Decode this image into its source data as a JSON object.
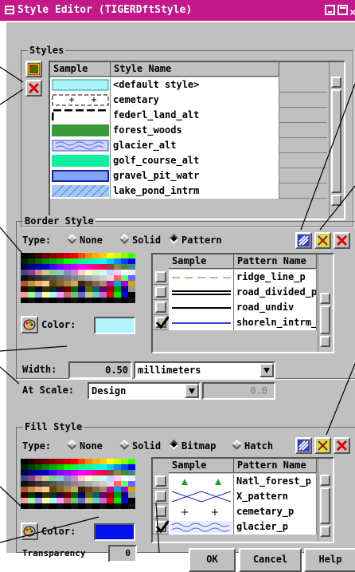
{
  "window": {
    "title": "Style Editor (TIGERDftStyle)"
  },
  "styles": {
    "group_label": "Styles",
    "col_sample": "Sample",
    "col_name": "Style Name",
    "rows": [
      {
        "name": "<default style>",
        "sample": "default"
      },
      {
        "name": "cemetary",
        "sample": "cemetary"
      },
      {
        "name": "federl_land_alt",
        "sample": "federal"
      },
      {
        "name": "forest_woods",
        "sample": "forest"
      },
      {
        "name": "glacier_alt",
        "sample": "glacier"
      },
      {
        "name": "golf_course_alt",
        "sample": "golf"
      },
      {
        "name": "gravel_pit_watr",
        "sample": "gravel"
      },
      {
        "name": "lake_pond_intrm",
        "sample": "lake"
      }
    ]
  },
  "border": {
    "group_label": "Border Style",
    "type_label": "Type:",
    "types": [
      "None",
      "Solid",
      "Pattern"
    ],
    "selected_type": "Pattern",
    "color_label": "Color:",
    "color": "#b4f4fc",
    "col_sample": "Sample",
    "col_name": "Pattern Name",
    "patterns": [
      {
        "name": "ridge_line_p",
        "checked": false
      },
      {
        "name": "road_divided_p",
        "checked": false
      },
      {
        "name": "road_undiv",
        "checked": false
      },
      {
        "name": "shoreln_intrm_",
        "checked": true
      }
    ],
    "width_label": "Width:",
    "width_value": "0.50",
    "width_units": "millimeters",
    "scale_label": "At Scale:",
    "scale_value": "Design",
    "scale_number": "0.0"
  },
  "fill": {
    "group_label": "Fill Style",
    "type_label": "Type:",
    "types": [
      "None",
      "Solid",
      "Bitmap",
      "Hatch"
    ],
    "selected_type": "Bitmap",
    "color_label": "Color:",
    "color": "#0010f0",
    "transparency_label": "Transparency",
    "transparency_value": "0",
    "col_sample": "Sample",
    "col_name": "Pattern Name",
    "patterns": [
      {
        "name": "Natl_forest_p",
        "checked": false
      },
      {
        "name": "X_pattern",
        "checked": false
      },
      {
        "name": "cemetary_p",
        "checked": false
      },
      {
        "name": "glacier_p",
        "checked": true
      }
    ]
  },
  "buttons": {
    "ok": "OK",
    "cancel": "Cancel",
    "help": "Help"
  },
  "colors": {
    "titlebar": "#c4188a",
    "dialog": "#c0c0c0",
    "leader_lines": "#000000"
  }
}
